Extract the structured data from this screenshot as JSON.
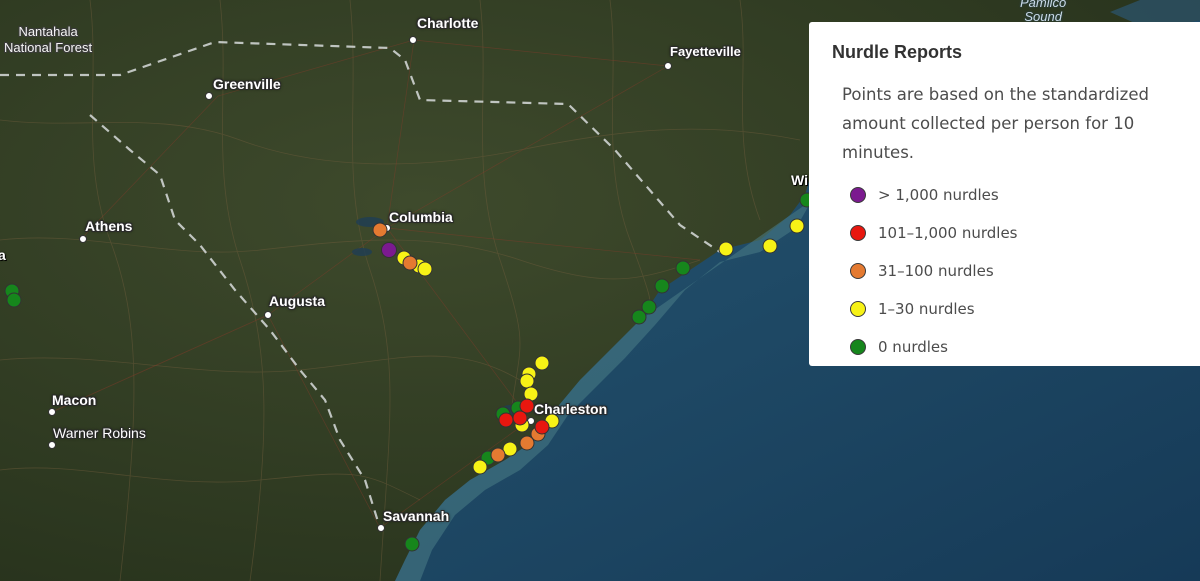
{
  "legend": {
    "title": "Nurdle Reports",
    "description": "Points are based on the standardized amount collected per person for 10 minutes.",
    "items": [
      {
        "label": "> 1,000 nurdles",
        "color": "#7b1a8f"
      },
      {
        "label": "101–1,000 nurdles",
        "color": "#e8170f"
      },
      {
        "label": "31–100 nurdles",
        "color": "#e47a31"
      },
      {
        "label": "1–30 nurdles",
        "color": "#f7f216"
      },
      {
        "label": "0 nurdles",
        "color": "#16861c"
      }
    ]
  },
  "map_labels": {
    "cities": {
      "charlotte": "Charlotte",
      "fayetteville": "Fayetteville",
      "greenville": "Greenville",
      "columbia": "Columbia",
      "athens": "Athens",
      "augusta": "Augusta",
      "macon": "Macon",
      "warner_robins": "Warner Robins",
      "charleston": "Charleston",
      "savannah": "Savannah"
    },
    "region": {
      "line1": "Nantahala",
      "line2": "National Forest"
    },
    "water": {
      "line1": "Pamlico",
      "line2": "Sound"
    },
    "edge_left": "a",
    "edge_right": "Wi"
  }
}
